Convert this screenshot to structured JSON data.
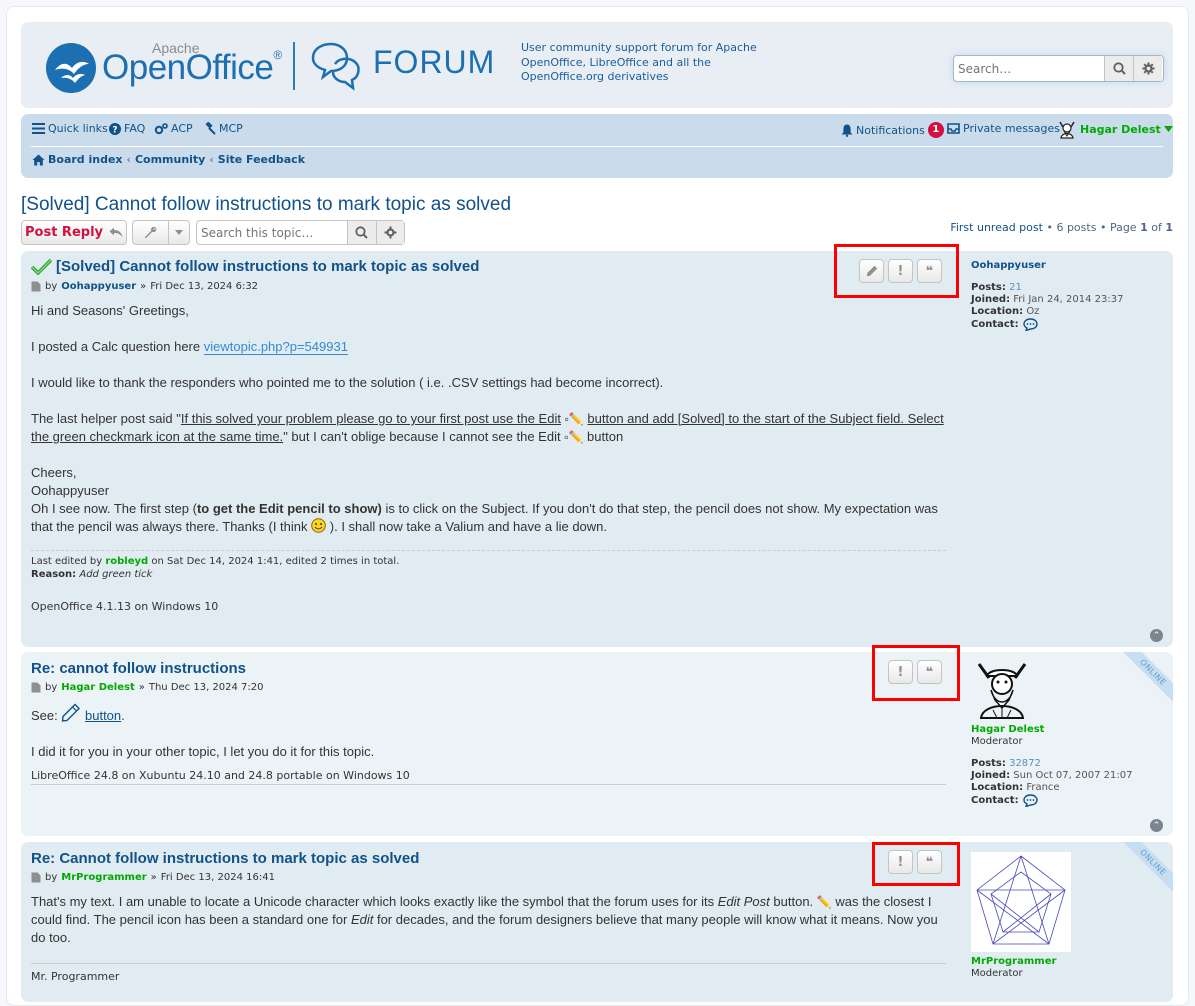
{
  "header": {
    "logo_apache": "Apache",
    "logo_openoffice": "OpenOffice",
    "logo_reg": "®",
    "logo_forum": "FORUM",
    "description": "User community support forum for Apache OpenOffice, LibreOffice and all the OpenOffice.org derivatives",
    "search_placeholder": "Search…"
  },
  "nav": {
    "quick_links": "Quick links",
    "faq": "FAQ",
    "acp": "ACP",
    "mcp": "MCP",
    "notifications": "Notifications",
    "notifications_count": "1",
    "private_messages": "Private messages",
    "username": "Hagar Delest",
    "breadcrumbs": [
      "Board index",
      "Community",
      "Site Feedback"
    ]
  },
  "topic": {
    "title": "[Solved] Cannot follow instructions to mark topic as solved",
    "post_reply": "Post Reply",
    "search_placeholder": "Search this topic…",
    "pagination": {
      "first_unread": "First unread post",
      "posts_count": "6 posts",
      "page_prefix": "Page",
      "page": "1",
      "of": "of",
      "total_pages": "1"
    }
  },
  "posts": [
    {
      "title": "[Solved] Cannot follow instructions to mark topic as solved",
      "by": "by",
      "author": "Oohappyuser",
      "date": "Fri Dec 13, 2024 6:32",
      "p1": "Hi and Seasons' Greetings,",
      "p2_text": "I posted a Calc question here",
      "p2_link": "viewtopic.php?p=549931",
      "p3": "I would like to thank the responders who pointed me to the solution ( i.e. .CSV settings had become incorrect).",
      "p4_a": "The last helper post said \"",
      "p4_quote1": "If this solved your problem please go to your first post use the Edit",
      "p4_quote2": "button and add [Solved] to the start of the Subject field. Select the green checkmark icon at the same time.",
      "p4_b": "\" but I can't oblige because I cannot see the Edit",
      "p4_c": "button",
      "p5a": "Cheers,",
      "p5b": "Oohappyuser",
      "p6_a": "Oh I see now. The first step (",
      "p6_bold": "to get the Edit pencil to show)",
      "p6_b": " is to click on the Subject. If you don't do that step, the pencil does not show. My expectation was that the pencil was always there. Thanks (I think",
      "p6_c": "). I shall now take a Valium and have a lie down.",
      "edit_prefix": "Last edited by",
      "edit_by": "robleyd",
      "edit_suffix": "on Sat Dec 14, 2024 1:41, edited 2 times in total.",
      "reason_label": "Reason:",
      "reason": "Add green tick",
      "signature": "OpenOffice 4.1.13 on Windows 10",
      "profile": {
        "name": "Oohappyuser",
        "posts_label": "Posts:",
        "posts": "21",
        "joined_label": "Joined:",
        "joined": "Fri Jan 24, 2014 23:37",
        "location_label": "Location:",
        "location": "Oz",
        "contact_label": "Contact:"
      }
    },
    {
      "title": "Re: cannot follow instructions",
      "by": "by",
      "author": "Hagar Delest",
      "date": "Thu Dec 13, 2024 7:20",
      "see": "See:",
      "button_link": "button",
      "p2": "I did it for you in your other topic, I let you do it for this topic.",
      "signature": "LibreOffice 24.8 on Xubuntu 24.10 and 24.8 portable on Windows 10",
      "online": "ONLINE",
      "profile": {
        "name": "Hagar Delest",
        "rank": "Moderator",
        "posts_label": "Posts:",
        "posts": "32872",
        "joined_label": "Joined:",
        "joined": "Sun Oct 07, 2007 21:07",
        "location_label": "Location:",
        "location": "France",
        "contact_label": "Contact:"
      }
    },
    {
      "title": "Re: Cannot follow instructions to mark topic as solved",
      "by": "by",
      "author": "MrProgrammer",
      "date": "Fri Dec 13, 2024 16:41",
      "p1_a": "That's my text. I am unable to locate a Unicode character which looks exactly like the symbol that the forum uses for its",
      "p1_em": "Edit Post",
      "p1_b": "button.",
      "p1_c": "was the closest I could find. The pencil icon has been a standard one for",
      "p1_em2": "Edit",
      "p1_d": "for decades, and the forum designers believe that many people will know what it means. Now you do too.",
      "signature": "Mr. Programmer",
      "online": "ONLINE",
      "profile": {
        "name": "MrProgrammer",
        "rank": "Moderator"
      }
    }
  ],
  "colors": {
    "link": "#105289",
    "moderator": "#00aa00",
    "reply": "#d31141",
    "highlight_box": "#ff0000"
  }
}
